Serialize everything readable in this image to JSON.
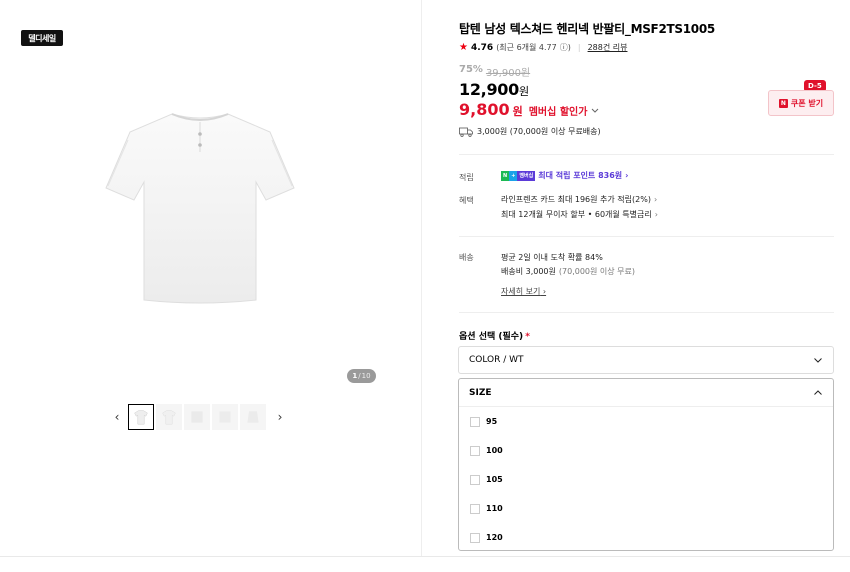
{
  "badge": "델디세일",
  "gallery": {
    "current": "1",
    "total": "10",
    "separator": "/"
  },
  "product": {
    "title": "탑텐 남성 텍스쳐드 헨리넥 반팔티_MSF2TS1005",
    "rating": "4.76",
    "rating_recent": "(최근 6개월 4.77",
    "rating_info": "ⓘ)",
    "reviews": "288건 리뷰",
    "discount_rate": "75%",
    "original_price": "39,900원",
    "price": "12,900",
    "price_unit": "원",
    "member_price": "9,800",
    "member_unit": "원",
    "member_label": "멤버십 할인가",
    "shipping": "3,000원 (70,000원 이상 무료배송)"
  },
  "coupon": {
    "dday": "D-5",
    "icon": "N",
    "label": "쿠폰 받기"
  },
  "benefits": {
    "point_label": "적립",
    "point_badges": [
      "N",
      "+",
      "멤버십"
    ],
    "point_text": "최대 적립 포인트 836원",
    "benefit_label": "혜택",
    "benefit_line1": "라인프렌즈 카드 최대 196원 추가 적립(2%)",
    "benefit_line2": "최대 12개월 무이자 할부 • 60개월 특별금리"
  },
  "delivery": {
    "label": "배송",
    "line1": "평균 2일 이내 도착 확률 84%",
    "line2_main": "배송비 3,000원",
    "line2_sub": "(70,000원 이상 무료)",
    "detail_link": "자세히 보기"
  },
  "options": {
    "label": "옵션 선택 (필수)",
    "required_mark": "*",
    "color_value": "COLOR / WT",
    "size_header": "SIZE",
    "sizes": [
      "95",
      "100",
      "105",
      "110",
      "120"
    ]
  },
  "colors": {
    "accent": "#e0112c",
    "point": "#5b3bd8"
  }
}
